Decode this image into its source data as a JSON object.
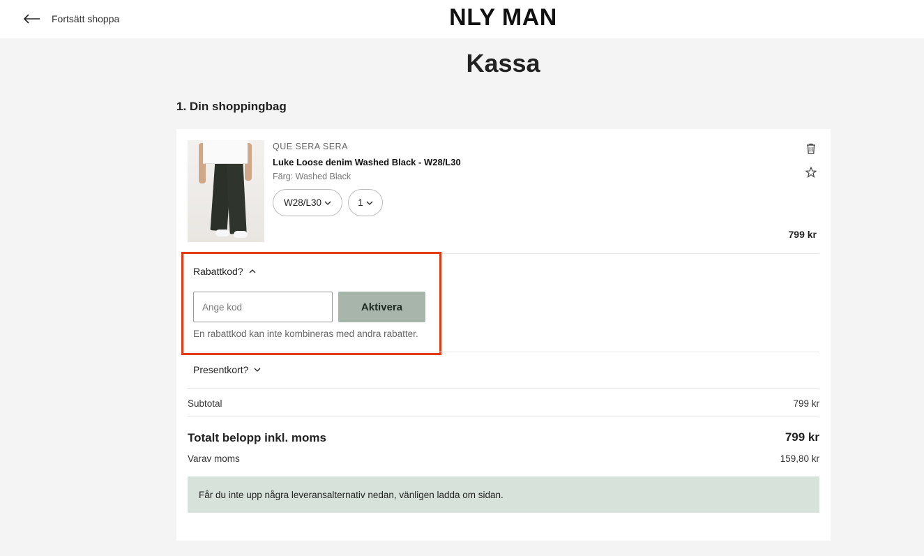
{
  "header": {
    "back_label": "Fortsätt shoppa",
    "logo": "NLY MAN"
  },
  "page": {
    "title": "Kassa",
    "section_title": "1. Din shoppingbag"
  },
  "cart": {
    "items": [
      {
        "brand": "QUE SERA SERA",
        "name": "Luke Loose denim Washed Black - W28/L30",
        "color": "Färg: Washed Black",
        "size": "W28/L30",
        "quantity": "1",
        "price": "799 kr"
      }
    ]
  },
  "discount": {
    "toggle_label": "Rabattkod?",
    "input_placeholder": "Ange kod",
    "button_label": "Aktivera",
    "note": "En rabattkod kan inte kombineras med andra rabatter."
  },
  "gift_card": {
    "toggle_label": "Presentkort?"
  },
  "summary": {
    "subtotal_label": "Subtotal",
    "subtotal_value": "799 kr",
    "total_label": "Totalt belopp inkl. moms",
    "total_value": "799 kr",
    "vat_label": "Varav moms",
    "vat_value": "159,80 kr"
  },
  "notice": {
    "text": "Får du inte upp några leveransalternativ nedan, vänligen ladda om sidan."
  },
  "colors": {
    "highlight_border": "#e13a15",
    "activate_button": "#a7b5ab",
    "notice_bg": "#d7e2db",
    "page_bg": "#f4f4f4"
  },
  "icons": {
    "back": "arrow-left-icon",
    "delete": "trash-icon",
    "favorite": "star-icon",
    "chevron_down": "chevron-down-icon",
    "chevron_up": "chevron-up-icon"
  }
}
